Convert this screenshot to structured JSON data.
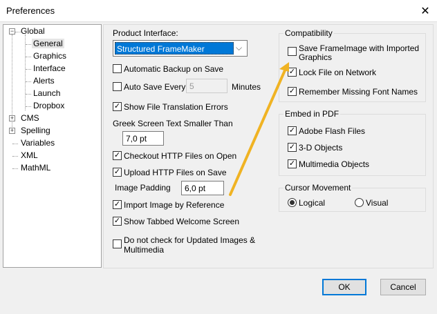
{
  "window": {
    "title": "Preferences",
    "close": "✕"
  },
  "tree": {
    "items": [
      {
        "label": "Global",
        "expander": "−"
      },
      {
        "label": "General"
      },
      {
        "label": "Graphics"
      },
      {
        "label": "Interface"
      },
      {
        "label": "Alerts"
      },
      {
        "label": "Launch"
      },
      {
        "label": "Dropbox"
      },
      {
        "label": "CMS",
        "expander": "+"
      },
      {
        "label": "Spelling",
        "expander": "+"
      },
      {
        "label": "Variables"
      },
      {
        "label": "XML"
      },
      {
        "label": "MathML"
      }
    ]
  },
  "general": {
    "product_interface_label": "Product Interface:",
    "product_interface_value": "Structured FrameMaker",
    "automatic_backup": {
      "label": "Automatic Backup on Save",
      "checked": false
    },
    "auto_save": {
      "label": "Auto Save Every",
      "checked": false,
      "value": "5",
      "unit": "Minutes"
    },
    "show_translation_errors": {
      "label": "Show File Translation Errors",
      "checked": true
    },
    "greek_label": "Greek Screen Text Smaller Than",
    "greek_value": "7,0 pt",
    "checkout_http": {
      "label": "Checkout HTTP Files on Open",
      "checked": true
    },
    "upload_http": {
      "label": "Upload HTTP Files on Save",
      "checked": true
    },
    "image_padding_label": "Image Padding",
    "image_padding_value": "6,0 pt",
    "import_by_reference": {
      "label": "Import Image by Reference",
      "checked": true
    },
    "tabbed_welcome": {
      "label": "Show Tabbed Welcome Screen",
      "checked": true
    },
    "no_check_updated": {
      "label": "Do not check for Updated Images & Multimedia",
      "line1": "Do not check for Updated Images &",
      "line2": "Multimedia",
      "checked": false
    }
  },
  "compatibility": {
    "title": "Compatibility",
    "save_frameimage": {
      "line1": "Save FrameImage with Imported",
      "line2": "Graphics",
      "checked": false
    },
    "lock_file": {
      "label": "Lock File on Network",
      "checked": true
    },
    "remember_fonts": {
      "label": "Remember Missing Font Names",
      "checked": true
    }
  },
  "embed_pdf": {
    "title": "Embed in PDF",
    "flash": {
      "label": "Adobe Flash Files",
      "checked": true
    },
    "objects3d": {
      "label": "3-D Objects",
      "checked": true
    },
    "multimedia": {
      "label": "Multimedia Objects",
      "checked": true
    }
  },
  "cursor": {
    "title": "Cursor Movement",
    "logical": "Logical",
    "visual": "Visual",
    "selected": "Logical"
  },
  "buttons": {
    "ok": "OK",
    "cancel": "Cancel"
  },
  "colors": {
    "accent": "#0078d7",
    "arrow": "#f0b323"
  }
}
